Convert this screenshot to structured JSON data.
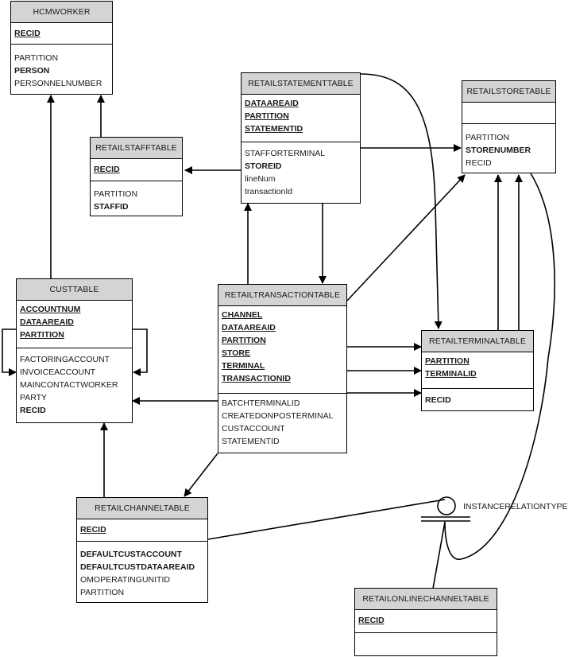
{
  "diagram": {
    "type": "entity-relationship",
    "tables": {
      "hcmworker": {
        "name": "HCMWORKER",
        "keys": [
          "RECID"
        ],
        "fields": [
          {
            "name": "PARTITION",
            "bold": false
          },
          {
            "name": "PERSON",
            "bold": true
          },
          {
            "name": "PERSONNELNUMBER",
            "bold": false
          }
        ]
      },
      "retailstatementtable": {
        "name": "RETAILSTATEMENTTABLE",
        "keys": [
          "DATAAREAID",
          "PARTITION",
          "STATEMENTID"
        ],
        "fields": [
          {
            "name": "STAFFORTERMINAL",
            "bold": false
          },
          {
            "name": "STOREID",
            "bold": true
          },
          {
            "name": "lineNum",
            "bold": false
          },
          {
            "name": "transactionId",
            "bold": false
          }
        ]
      },
      "retailstoretable": {
        "name": "RETAILSTORETABLE",
        "keys": [],
        "fields": [
          {
            "name": "PARTITION",
            "bold": false
          },
          {
            "name": "STORENUMBER",
            "bold": true
          },
          {
            "name": "RECID",
            "bold": false
          }
        ]
      },
      "retailstafftable": {
        "name": "RETAILSTAFFTABLE",
        "keys": [
          "RECID"
        ],
        "fields": [
          {
            "name": "PARTITION",
            "bold": false
          },
          {
            "name": "STAFFID",
            "bold": true
          }
        ]
      },
      "custtable": {
        "name": "CUSTTABLE",
        "keys": [
          "ACCOUNTNUM",
          "DATAAREAID",
          "PARTITION"
        ],
        "fields": [
          {
            "name": "FACTORINGACCOUNT",
            "bold": false
          },
          {
            "name": "INVOICEACCOUNT",
            "bold": false
          },
          {
            "name": "MAINCONTACTWORKER",
            "bold": false
          },
          {
            "name": "PARTY",
            "bold": false
          },
          {
            "name": "RECID",
            "bold": true
          }
        ]
      },
      "retailtransactiontable": {
        "name": "RETAILTRANSACTIONTABLE",
        "keys": [
          "CHANNEL",
          "DATAAREAID",
          "PARTITION",
          "STORE",
          "TERMINAL",
          "TRANSACTIONID"
        ],
        "fields": [
          {
            "name": "BATCHTERMINALID",
            "bold": false
          },
          {
            "name": "CREATEDONPOSTERMINAL",
            "bold": false
          },
          {
            "name": "CUSTACCOUNT",
            "bold": false
          },
          {
            "name": "STATEMENTID",
            "bold": false
          }
        ]
      },
      "retailterminaltable": {
        "name": "RETAILTERMINALTABLE",
        "keys": [
          "PARTITION",
          "TERMINALID"
        ],
        "fields": [
          {
            "name": "RECID",
            "bold": true
          }
        ]
      },
      "retailchanneltable": {
        "name": "RETAILCHANNELTABLE",
        "keys": [
          "RECID"
        ],
        "fields": [
          {
            "name": "DEFAULTCUSTACCOUNT",
            "bold": true
          },
          {
            "name": "DEFAULTCUSTDATAAREAID",
            "bold": true
          },
          {
            "name": "OMOPERATINGUNITID",
            "bold": false
          },
          {
            "name": "PARTITION",
            "bold": false
          }
        ]
      },
      "retailonlinechanneltable": {
        "name": "RETAILONLINECHANNELTABLE",
        "keys": [
          "RECID"
        ],
        "fields": []
      }
    },
    "inheritance_label": "INSTANCERELATIONTYPE",
    "relationships": [
      {
        "from": "RETAILSTAFFTABLE",
        "to": "HCMWORKER"
      },
      {
        "from": "CUSTTABLE",
        "to": "HCMWORKER"
      },
      {
        "from": "RETAILSTATEMENTTABLE",
        "to": "RETAILSTAFFTABLE"
      },
      {
        "from": "RETAILSTATEMENTTABLE",
        "to": "RETAILSTORETABLE"
      },
      {
        "from": "RETAILSTATEMENTTABLE",
        "to": "RETAILTERMINALTABLE"
      },
      {
        "from": "RETAILSTATEMENTTABLE",
        "to": "RETAILTRANSACTIONTABLE"
      },
      {
        "from": "RETAILTRANSACTIONTABLE",
        "to": "RETAILSTATEMENTTABLE"
      },
      {
        "from": "RETAILTRANSACTIONTABLE",
        "to": "RETAILSTORETABLE"
      },
      {
        "from": "RETAILTRANSACTIONTABLE",
        "to": "RETAILTERMINALTABLE"
      },
      {
        "from": "RETAILTRANSACTIONTABLE",
        "to": "CUSTTABLE"
      },
      {
        "from": "RETAILTRANSACTIONTABLE",
        "to": "RETAILCHANNELTABLE"
      },
      {
        "from": "RETAILTERMINALTABLE",
        "to": "RETAILSTORETABLE"
      },
      {
        "from": "CUSTTABLE",
        "to": "CUSTTABLE"
      },
      {
        "from": "RETAILCHANNELTABLE",
        "to": "CUSTTABLE"
      },
      {
        "from": "RETAILONLINECHANNELTABLE",
        "to": "RETAILCHANNELTABLE"
      },
      {
        "from": "RETAILSTORETABLE",
        "to": "RETAILCHANNELTABLE"
      }
    ]
  }
}
